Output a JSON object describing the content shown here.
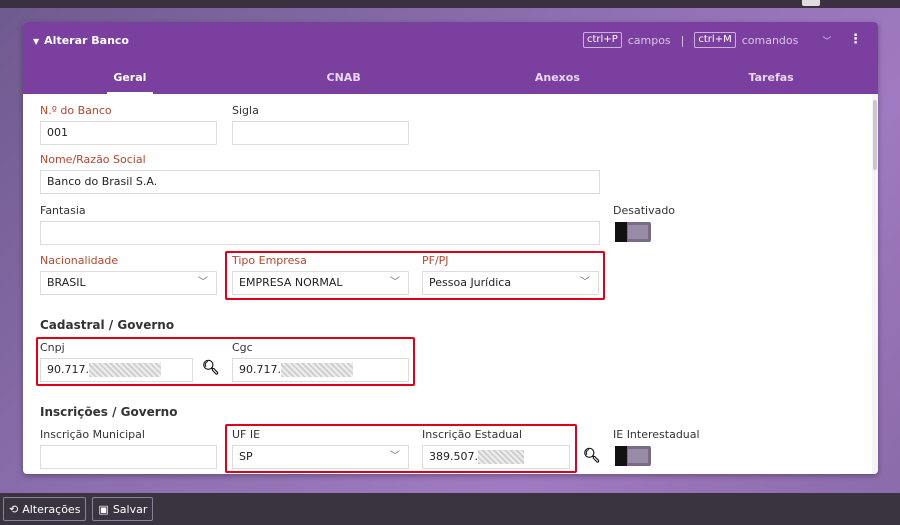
{
  "panel": {
    "title": "Alterar Banco",
    "shortcuts": {
      "kbd1": "ctrl+P",
      "text1": "campos",
      "sep": "|",
      "kbd2": "ctrl+M",
      "text2": "comandos"
    }
  },
  "tabs": [
    {
      "label": "Geral"
    },
    {
      "label": "CNAB"
    },
    {
      "label": "Anexos"
    },
    {
      "label": "Tarefas"
    }
  ],
  "form": {
    "numero_banco": {
      "label": "N.º do Banco",
      "value": "001"
    },
    "sigla": {
      "label": "Sigla",
      "value": ""
    },
    "razao_social": {
      "label": "Nome/Razão Social",
      "value": "Banco do Brasil S.A."
    },
    "fantasia": {
      "label": "Fantasia",
      "value": ""
    },
    "desativado": {
      "label": "Desativado"
    },
    "nacionalidade": {
      "label": "Nacionalidade",
      "value": "BRASIL"
    },
    "tipo_empresa": {
      "label": "Tipo Empresa",
      "value": "EMPRESA NORMAL"
    },
    "pf_pj": {
      "label": "PF/PJ",
      "value": "Pessoa Jurídica"
    },
    "cadastral_title": "Cadastral / Governo",
    "cnpj": {
      "label": "Cnpj",
      "value": "90.717."
    },
    "cgc": {
      "label": "Cgc",
      "value": "90.717."
    },
    "inscricoes_title": "Inscrições / Governo",
    "inscricao_municipal": {
      "label": "Inscrição Municipal",
      "value": ""
    },
    "uf_ie": {
      "label": "UF IE",
      "value": "SP"
    },
    "inscricao_estadual": {
      "label": "Inscrição Estadual",
      "value": "389.507."
    },
    "ie_interestadual": {
      "label": "IE Interestadual"
    }
  },
  "footer": {
    "alteracoes": "Alterações",
    "salvar": "Salvar"
  },
  "colors": {
    "header": "#7b3fa0",
    "required_label": "#b5462d",
    "highlight": "#e0001b"
  }
}
